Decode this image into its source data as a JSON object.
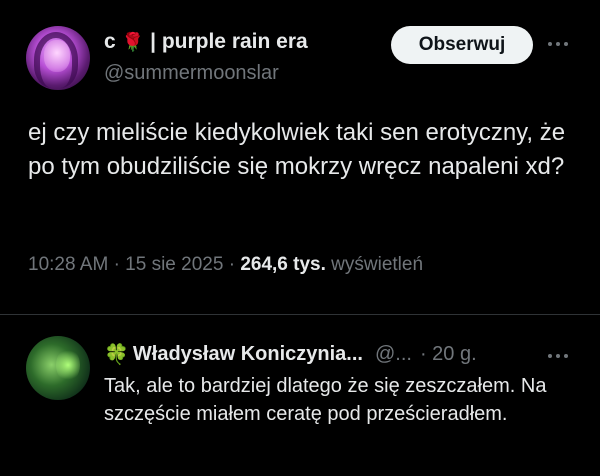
{
  "tweet": {
    "author": {
      "name_prefix": "c",
      "name_suffix": "| purple rain era",
      "emoji": "rose-icon",
      "handle": "@summermoonslar"
    },
    "follow_label": "Obserwuj",
    "text": "ej czy mieliście kiedykolwiek taki sen erotyczny, że po tym obudziliście się mokrzy wręcz napaleni xd?",
    "time": "10:28 AM",
    "date": "15 sie 2025",
    "views_count": "264,6 tys.",
    "views_label": "wyświetleń"
  },
  "reply": {
    "author": {
      "emoji": "clover-icon",
      "name": "Władysław Koniczynia...",
      "handle": "@...",
      "age": "· 20 g."
    },
    "text": "Tak, ale to bardziej dlatego że się zeszczałem. Na szczęście miałem ceratę pod prześcieradłem."
  },
  "colors": {
    "background": "#000000",
    "text_primary": "#e7e9ea",
    "text_secondary": "#71767b",
    "divider": "#2f3336",
    "button_bg": "#eff3f4"
  }
}
